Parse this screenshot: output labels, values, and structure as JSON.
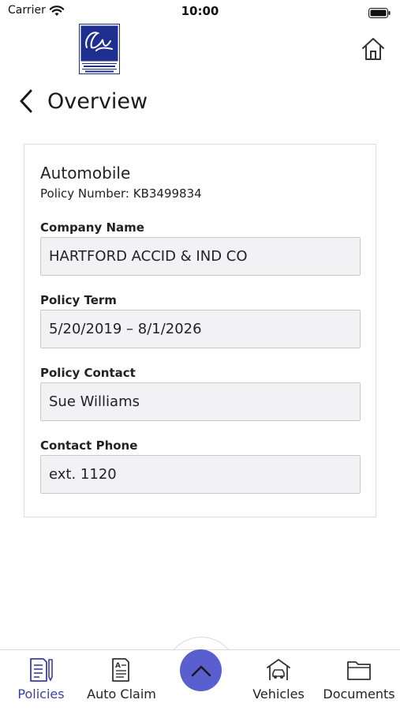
{
  "status_bar": {
    "carrier": "Carrier",
    "time": "10:00"
  },
  "header": {
    "logo_icon": "cassidys-associated-insurers-logo",
    "home_icon": "home-icon",
    "back_icon": "chevron-left-icon",
    "title": "Overview"
  },
  "policy": {
    "type": "Automobile",
    "number_label": "Policy Number:",
    "number": "KB3499834",
    "fields": [
      {
        "label": "Company Name",
        "value": "HARTFORD ACCID & IND CO"
      },
      {
        "label": "Policy Term",
        "value": "5/20/2019 – 8/1/2026"
      },
      {
        "label": "Policy Contact",
        "value": "Sue Williams"
      },
      {
        "label": "Contact Phone",
        "value": "ext. 1120"
      }
    ]
  },
  "tab_bar": {
    "tabs": [
      {
        "label": "Policies",
        "icon": "policy-document-icon",
        "active": true
      },
      {
        "label": "Auto Claim",
        "icon": "claim-form-icon",
        "active": false
      },
      {
        "label": "Vehicles",
        "icon": "garage-car-icon",
        "active": false
      },
      {
        "label": "Documents",
        "icon": "folder-icon",
        "active": false
      }
    ],
    "fab_icon": "chevron-up-icon"
  },
  "colors": {
    "accent": "#5a5fd0",
    "active_tab": "#3a3fa8",
    "field_bg": "#f2f2f4",
    "logo_blue": "#1f2f8f"
  }
}
